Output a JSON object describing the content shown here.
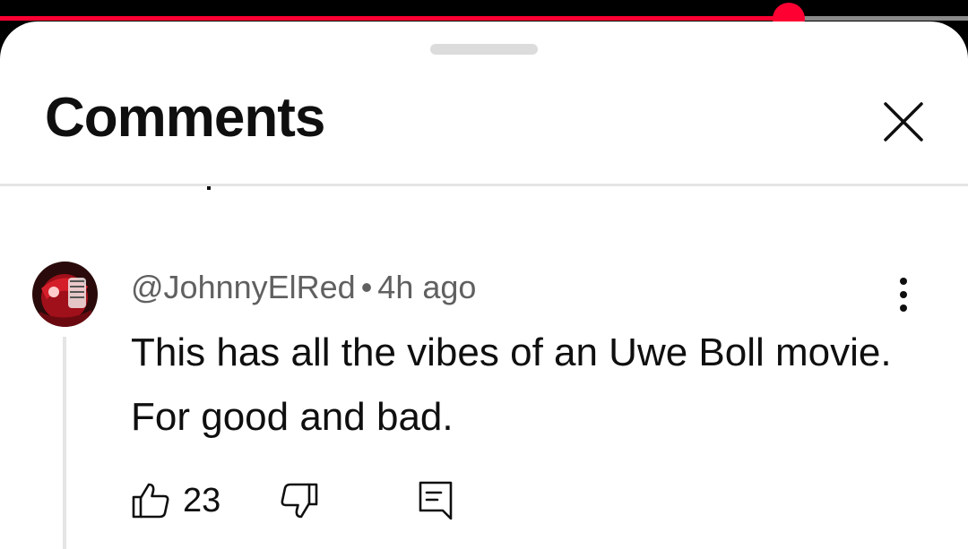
{
  "player": {
    "progress_fraction": 0.815,
    "played_color": "#ff0033"
  },
  "sheet": {
    "title": "Comments"
  },
  "comment": {
    "author": "@JohnnyElRed",
    "separator": "•",
    "time": "4h ago",
    "text": "This has all the vibes of an Uwe Boll movie. For good and bad.",
    "like_count": "23"
  },
  "icons": {
    "close": "close-icon",
    "more": "more-vert-icon",
    "like": "thumb-up-icon",
    "dislike": "thumb-down-icon",
    "reply": "reply-icon"
  }
}
